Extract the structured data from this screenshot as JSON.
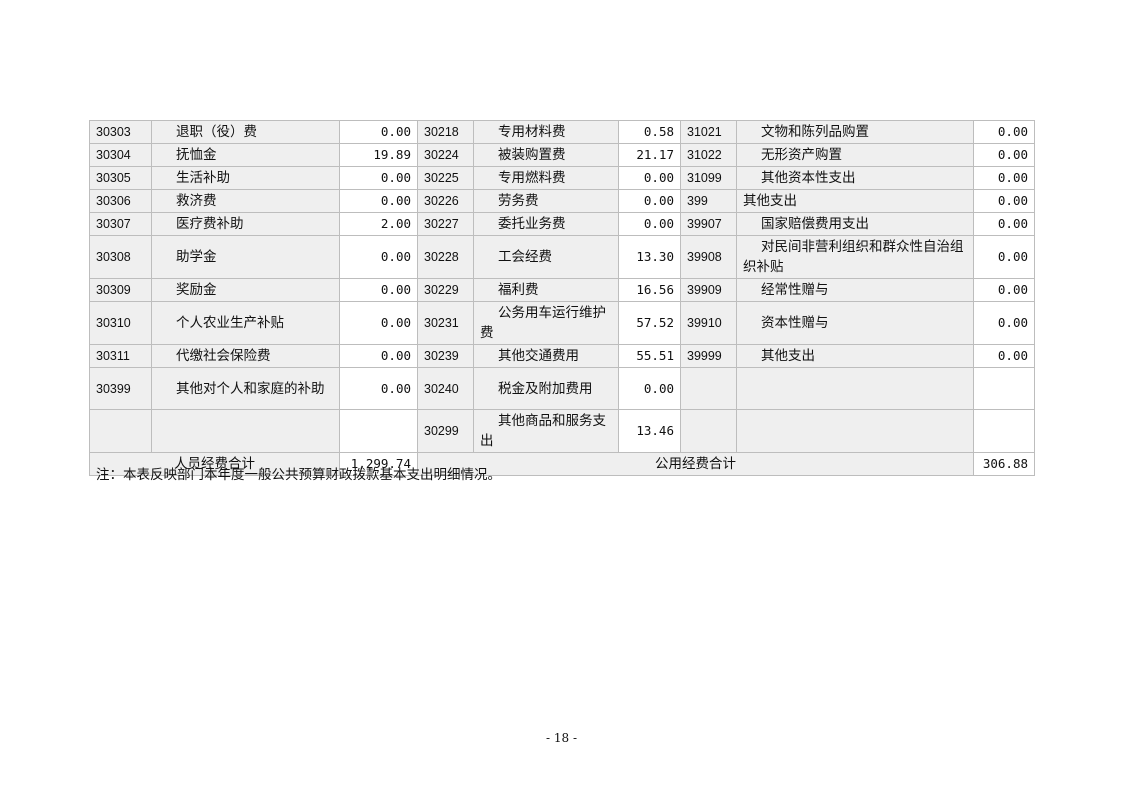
{
  "table": {
    "rows": [
      {
        "c1": "30303",
        "n1": "退职（役）费",
        "v1": "0.00",
        "c2": "30218",
        "n2": "专用材料费",
        "v2": "0.58",
        "c3": "31021",
        "n3": "文物和陈列品购置",
        "v3": "0.00"
      },
      {
        "c1": "30304",
        "n1": "抚恤金",
        "v1": "19.89",
        "c2": "30224",
        "n2": "被装购置费",
        "v2": "21.17",
        "c3": "31022",
        "n3": "无形资产购置",
        "v3": "0.00"
      },
      {
        "c1": "30305",
        "n1": "生活补助",
        "v1": "0.00",
        "c2": "30225",
        "n2": "专用燃料费",
        "v2": "0.00",
        "c3": "31099",
        "n3": "其他资本性支出",
        "v3": "0.00"
      },
      {
        "c1": "30306",
        "n1": "救济费",
        "v1": "0.00",
        "c2": "30226",
        "n2": "劳务费",
        "v2": "0.00",
        "c3": "399",
        "n3": "其他支出",
        "v3": "0.00"
      },
      {
        "c1": "30307",
        "n1": "医疗费补助",
        "v1": "2.00",
        "c2": "30227",
        "n2": "委托业务费",
        "v2": "0.00",
        "c3": "39907",
        "n3": "国家赔偿费用支出",
        "v3": "0.00"
      },
      {
        "c1": "30308",
        "n1": "助学金",
        "v1": "0.00",
        "c2": "30228",
        "n2": "工会经费",
        "v2": "13.30",
        "c3": "39908",
        "n3": "对民间非营利组织和群众性自治组织补贴",
        "v3": "0.00"
      },
      {
        "c1": "30309",
        "n1": "奖励金",
        "v1": "0.00",
        "c2": "30229",
        "n2": "福利费",
        "v2": "16.56",
        "c3": "39909",
        "n3": "经常性赠与",
        "v3": "0.00"
      },
      {
        "c1": "30310",
        "n1": "个人农业生产补贴",
        "v1": "0.00",
        "c2": "30231",
        "n2": "公务用车运行维护费",
        "v2": "57.52",
        "c3": "39910",
        "n3": "资本性赠与",
        "v3": "0.00"
      },
      {
        "c1": "30311",
        "n1": "代缴社会保险费",
        "v1": "0.00",
        "c2": "30239",
        "n2": "其他交通费用",
        "v2": "55.51",
        "c3": "39999",
        "n3": "其他支出",
        "v3": "0.00"
      },
      {
        "c1": "30399",
        "n1": "其他对个人和家庭的补助",
        "v1": "0.00",
        "c2": "30240",
        "n2": "税金及附加费用",
        "v2": "0.00",
        "c3": "",
        "n3": "",
        "v3": ""
      },
      {
        "c1": "",
        "n1": "",
        "v1": "",
        "c2": "30299",
        "n2": "其他商品和服务支出",
        "v2": "13.46",
        "c3": "",
        "n3": "",
        "v3": ""
      }
    ],
    "totals": {
      "personnel_label": "人员经费合计",
      "personnel_value": "1,299.74",
      "public_label": "公用经费合计",
      "public_value": "306.88"
    }
  },
  "note": "注：本表反映部门本年度一般公共预算财政拨款基本支出明细情况。",
  "page_number": "- 18 -"
}
